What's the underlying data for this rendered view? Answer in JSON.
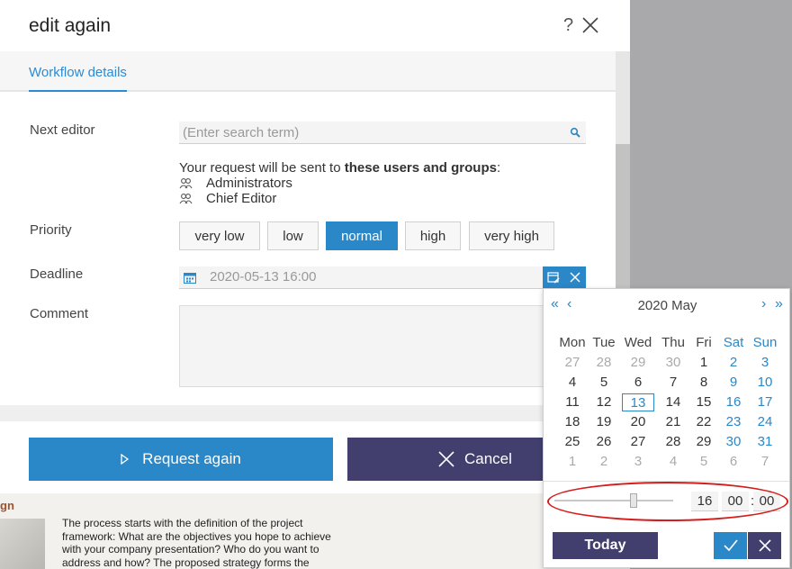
{
  "dialog": {
    "title": "edit again",
    "help_label": "?",
    "tab_label": "Workflow details"
  },
  "form": {
    "next_editor_label": "Next editor",
    "search_placeholder": "(Enter search term)",
    "send_prefix": "Your request will be sent to ",
    "send_emphasis": "these users and groups",
    "send_suffix": ":",
    "recipients": [
      "Administrators",
      "Chief Editor"
    ],
    "priority_label": "Priority",
    "priority_options": [
      "very low",
      "low",
      "normal",
      "high",
      "very high"
    ],
    "priority_selected": "normal",
    "deadline_label": "Deadline",
    "deadline_value": "2020-05-13 16:00",
    "comment_label": "Comment"
  },
  "footer": {
    "request_label": "Request again",
    "cancel_label": "Cancel"
  },
  "datepicker": {
    "nav_prev_year": "«",
    "nav_prev_month": "‹",
    "nav_next_month": "›",
    "nav_next_year": "»",
    "month_title": "2020 May",
    "weekdays": [
      "Mon",
      "Tue",
      "Wed",
      "Thu",
      "Fri",
      "Sat",
      "Sun"
    ],
    "weeks": [
      [
        "27",
        "28",
        "29",
        "30",
        "1",
        "2",
        "3"
      ],
      [
        "4",
        "5",
        "6",
        "7",
        "8",
        "9",
        "10"
      ],
      [
        "11",
        "12",
        "13",
        "14",
        "15",
        "16",
        "17"
      ],
      [
        "18",
        "19",
        "20",
        "21",
        "22",
        "23",
        "24"
      ],
      [
        "25",
        "26",
        "27",
        "28",
        "29",
        "30",
        "31"
      ],
      [
        "1",
        "2",
        "3",
        "4",
        "5",
        "6",
        "7"
      ]
    ],
    "selected_day": "13",
    "time": {
      "hour": "16",
      "minute": "00",
      "second": "00"
    },
    "today_label": "Today"
  },
  "background_page": {
    "heading_fragment": "gn",
    "paragraph": "The process starts with the definition of the project framework: What are the objectives you hope to achieve with your company presentation? Who do you want to address and how? The proposed strategy forms the"
  },
  "colors": {
    "accent_blue": "#2a87c8",
    "dark_purple": "#423f6e",
    "annotation_red": "#d51d1d"
  }
}
